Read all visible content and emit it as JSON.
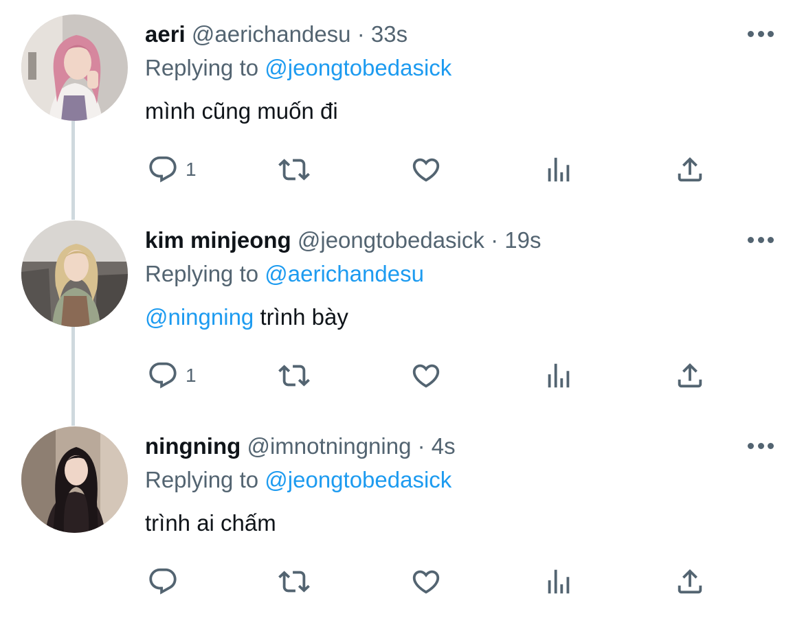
{
  "tweets": [
    {
      "name": "aeri",
      "handle": "@aerichandesu",
      "separator": "·",
      "time": "33s",
      "replying_prefix": "Replying to",
      "replying_to": "@jeongtobedasick",
      "text": "mình cũng muốn đi",
      "reply_count": "1",
      "avatar_icon": "avatar-aeri"
    },
    {
      "name": "kim minjeong",
      "handle": "@jeongtobedasick",
      "separator": "·",
      "time": "19s",
      "replying_prefix": "Replying to",
      "replying_to": "@aerichandesu",
      "text_mention": "@ningning",
      "text": " trình bày",
      "reply_count": "1",
      "avatar_icon": "avatar-minjeong"
    },
    {
      "name": "ningning",
      "handle": "@imnotningning",
      "separator": "·",
      "time": "4s",
      "replying_prefix": "Replying to",
      "replying_to": "@jeongtobedasick",
      "text": "trình ai chấm",
      "reply_count": "",
      "avatar_icon": "avatar-ningning"
    }
  ],
  "icons": {
    "reply": "reply-icon",
    "retweet": "retweet-icon",
    "like": "like-icon",
    "views": "views-icon",
    "share": "share-icon",
    "more": "more-icon"
  },
  "colors": {
    "link": "#1d9bf0",
    "secondary_text": "#536471",
    "thread_line": "#cfd9de"
  }
}
